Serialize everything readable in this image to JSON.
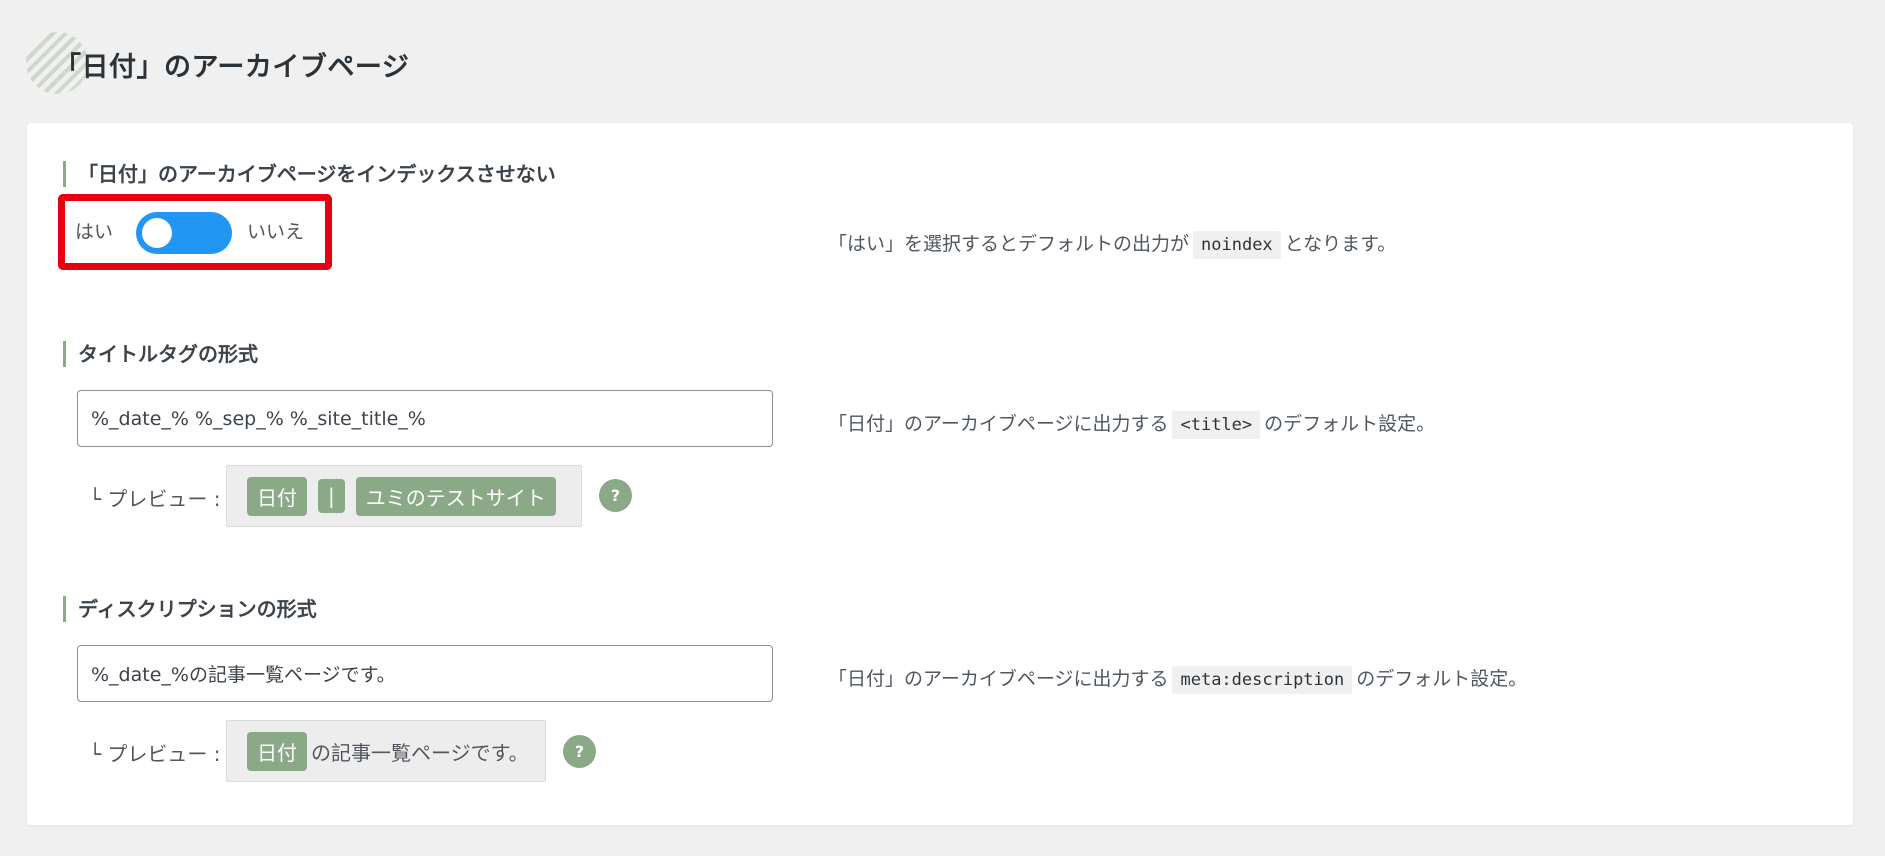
{
  "page": {
    "title": "「日付」のアーカイブページ"
  },
  "noindex_section": {
    "heading": "「日付」のアーカイブページをインデックスさせない",
    "toggle_yes": "はい",
    "toggle_no": "いいえ",
    "toggle_state": "on",
    "desc_before": "「はい」を選択するとデフォルトの出力が",
    "desc_code": "noindex",
    "desc_after": "となります。"
  },
  "title_section": {
    "heading": "タイトルタグの形式",
    "input_value": "%_date_% %_sep_% %_site_title_%",
    "preview_label": "└ プレビュー :",
    "preview_chips": [
      "日付",
      "|",
      "ユミのテストサイト"
    ],
    "desc_before": "「日付」のアーカイブページに出力する",
    "desc_code": "<title>",
    "desc_after": "のデフォルト設定。",
    "help": "?"
  },
  "description_section": {
    "heading": "ディスクリプションの形式",
    "input_value": "%_date_%の記事一覧ページです。",
    "preview_label": "└ プレビュー :",
    "preview_chip": "日付",
    "preview_text": "の記事一覧ページです。",
    "desc_before": "「日付」のアーカイブページに出力する",
    "desc_code": "meta:description",
    "desc_after": "のデフォルト設定。",
    "help": "?"
  },
  "colors": {
    "accent_green": "#8aaa87",
    "toggle_blue": "#2196f3",
    "highlight_red": "#e60012"
  }
}
